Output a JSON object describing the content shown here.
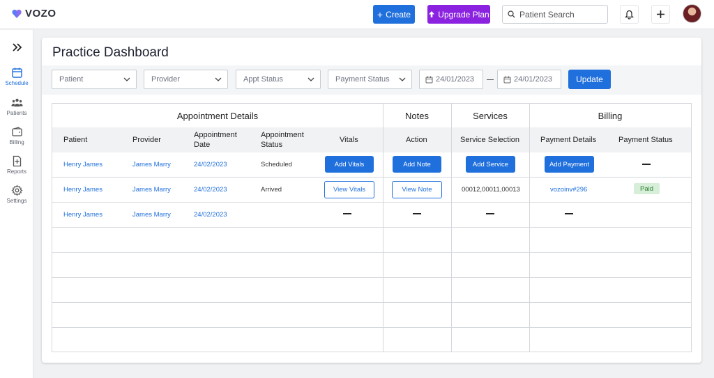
{
  "app": {
    "brand": "VOZO"
  },
  "topbar": {
    "create_label": "Create",
    "upgrade_label": "Upgrade Plan",
    "search_placeholder": "Patient Search"
  },
  "sidebar": {
    "items": [
      {
        "label": "Schedule",
        "icon": "calendar-icon",
        "active": true
      },
      {
        "label": "Patients",
        "icon": "people-icon",
        "active": false
      },
      {
        "label": "Billing",
        "icon": "wallet-icon",
        "active": false
      },
      {
        "label": "Reports",
        "icon": "report-icon",
        "active": false
      },
      {
        "label": "Settings",
        "icon": "gear-icon",
        "active": false
      }
    ]
  },
  "page": {
    "title": "Practice Dashboard"
  },
  "filters": {
    "patient": "Patient",
    "provider": "Provider",
    "appt_status": "Appt Status",
    "payment_status": "Payment Status",
    "date_from": "24/01/2023",
    "date_to": "24/01/2023",
    "update_label": "Update"
  },
  "table": {
    "groups": {
      "appointment": "Appointment Details",
      "notes": "Notes",
      "services": "Services",
      "billing": "Billing"
    },
    "columns": {
      "patient": "Patient",
      "provider": "Provider",
      "appt_date": "Appointment Date",
      "appt_status": "Appointment Status",
      "vitals": "Vitals",
      "action": "Action",
      "service_selection": "Service Selection",
      "payment_details": "Payment Details",
      "payment_status": "Payment Status"
    },
    "rows": [
      {
        "patient": "Henry James",
        "provider": "James Marry",
        "date": "24/02/2023",
        "status": "Scheduled",
        "vitals": "Add Vitals",
        "action": "Add  Note",
        "service": "Add Service",
        "payment": "Add Payment",
        "payment_status": ""
      },
      {
        "patient": "Henry James",
        "provider": "James Marry",
        "date": "24/02/2023",
        "status": "Arrived",
        "vitals": "View Vitals",
        "action": "View Note",
        "service": "00012,00011,00013",
        "payment": "vozoinv#296",
        "payment_status": "Paid"
      },
      {
        "patient": "Henry James",
        "provider": "James Marry",
        "date": "24/02/2023",
        "status": "",
        "vitals": "",
        "action": "",
        "service": "",
        "payment": "",
        "payment_status": ""
      }
    ]
  },
  "colors": {
    "primary": "#1f6fdc",
    "upgrade": "#8a22e0",
    "paid_bg": "#d7efd9",
    "paid_text": "#2e7d32"
  }
}
